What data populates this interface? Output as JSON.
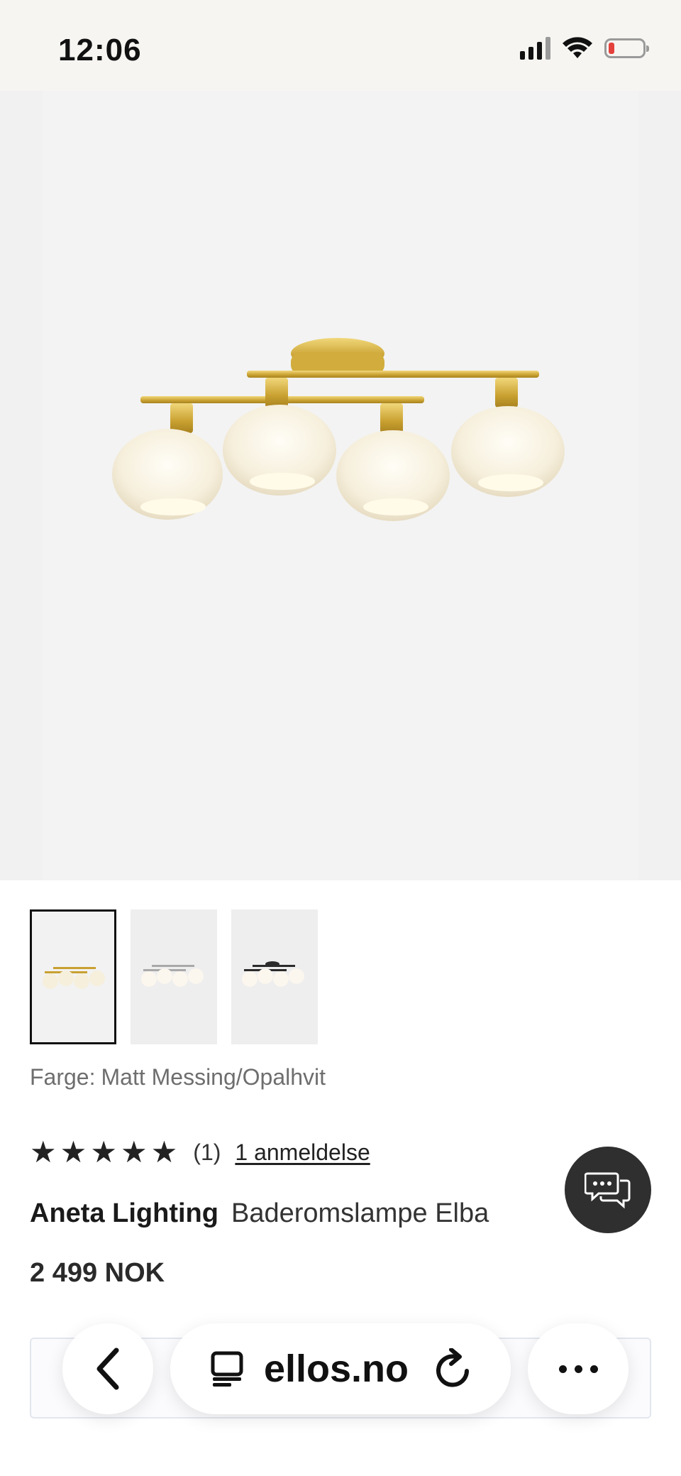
{
  "status_bar": {
    "time": "12:06",
    "battery_color": "#e5413c",
    "icons": [
      "signal-icon",
      "wifi-icon",
      "battery-low-icon"
    ]
  },
  "product": {
    "thumbnails": [
      {
        "variant_icon": "lamp-brass-thumb",
        "selected": true
      },
      {
        "variant_icon": "lamp-chrome-thumb",
        "selected": false
      },
      {
        "variant_icon": "lamp-black-thumb",
        "selected": false
      }
    ],
    "color_label": "Farge:",
    "color_value": "Matt Messing/Opalhvit",
    "rating": {
      "stars": 5,
      "max_stars": 5,
      "count_text": "(1)",
      "review_link": "1 anmeldelse"
    },
    "brand": "Aneta Lighting",
    "name": "Baderomslampe Elba",
    "price": "2 499 NOK"
  },
  "browser": {
    "url": "ellos.no",
    "icons": [
      "back-icon",
      "tabs-icon",
      "reload-icon",
      "more-icon"
    ]
  },
  "colors": {
    "accent_dark": "#2f2f2f",
    "brass": "#d6b23e"
  }
}
